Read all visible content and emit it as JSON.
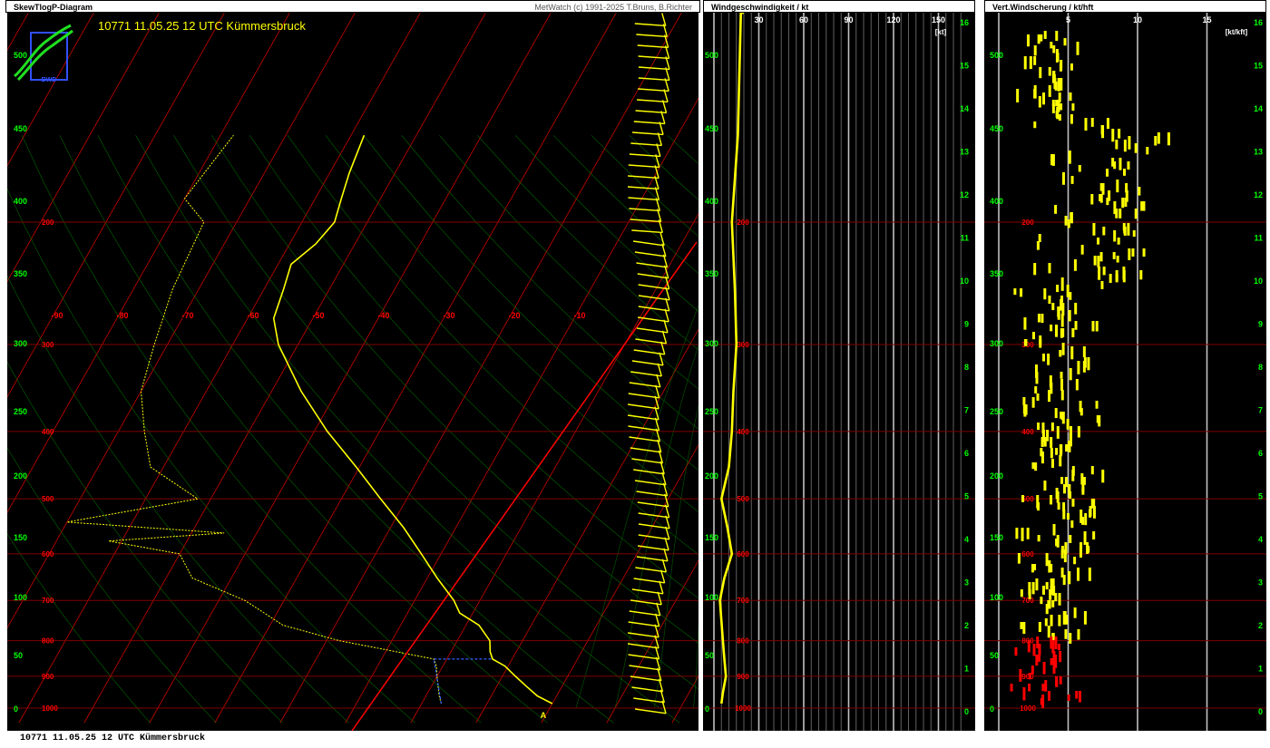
{
  "panels": {
    "skewt": {
      "title": "SkewTlogP-Diagram",
      "credit": "MetWatch  (c) 1991-2025 T.Bruns, B.Richter"
    },
    "wind": {
      "title": "Windgeschwindigkeit / kt"
    },
    "shear": {
      "title": "Vert.Windscherung / kt/hft"
    }
  },
  "station_label": "10771 11.05.25 12 UTC Kümmersbruck",
  "footer": "10771 11.05.25 12 UTC Kümmersbruck",
  "logo": {
    "text": "DWD",
    "icon": "dwd-logo-icon"
  },
  "colors": {
    "background": "#000000",
    "isotherm": "#ff0000",
    "isobar": "#800000",
    "adiabat": "#008000",
    "profile": "#ffff00",
    "parcel": "#ff0000",
    "level_text": "#00ff00",
    "shear_low": "#ff0000"
  },
  "chart_data": [
    {
      "type": "line",
      "name": "skewt",
      "pressure_levels": [
        "200",
        "300",
        "400",
        "500",
        "600",
        "700",
        "800",
        "900",
        "1000"
      ],
      "temperature_ticks": [
        "-90",
        "-80",
        "-70",
        "-60",
        "-50",
        "-40",
        "-30",
        "-20",
        "-10"
      ],
      "height_ticks_hpa": [
        "500",
        "450",
        "400",
        "350",
        "300",
        "250",
        "200",
        "150",
        "100",
        "50",
        "0"
      ],
      "height_ticks_km": [
        "16",
        "15",
        "14",
        "13",
        "12",
        "11",
        "10",
        "9",
        "8",
        "7",
        "6",
        "5",
        "4",
        "3",
        "2",
        "1",
        "0"
      ],
      "temperature_profile": {
        "p": [
          985,
          960,
          930,
          900,
          870,
          850,
          830,
          800,
          760,
          730,
          700,
          650,
          600,
          550,
          500,
          450,
          400,
          350,
          300,
          275,
          250,
          230,
          215,
          200,
          185,
          170,
          150
        ],
        "t": [
          20,
          17,
          14.5,
          12,
          9.5,
          7,
          6,
          5,
          2,
          -2,
          -4,
          -8.5,
          -13,
          -18,
          -24,
          -30.5,
          -38,
          -45.5,
          -53,
          -56,
          -57,
          -58,
          -56,
          -55,
          -56,
          -57,
          -58
        ]
      },
      "dewpoint_profile": {
        "p": [
          985,
          960,
          930,
          900,
          870,
          850,
          800,
          760,
          700,
          650,
          600,
          575,
          560,
          540,
          500,
          450,
          400,
          350,
          300,
          250,
          200,
          185,
          150
        ],
        "t": [
          3,
          2,
          1,
          0,
          -1,
          -2,
          -18,
          -28,
          -36,
          -46,
          -50,
          -62,
          -45,
          -70,
          -52,
          -62,
          -66,
          -70,
          -72,
          -74,
          -75,
          -80,
          -78
        ]
      },
      "parcel_path": {
        "p": [
          985,
          850,
          700,
          500,
          300,
          250,
          200
        ],
        "t": [
          20,
          5,
          -8,
          -25,
          -50,
          -58,
          -66
        ]
      },
      "parcel_label": "A"
    },
    {
      "type": "line",
      "name": "wind_speed",
      "x_ticks": [
        "30",
        "60",
        "90",
        "120",
        "150"
      ],
      "unit": "[kt]",
      "xlim": [
        0,
        165
      ],
      "height_ticks_hpa": [
        "500",
        "450",
        "400",
        "350",
        "300",
        "250",
        "200",
        "150",
        "100",
        "50",
        "0"
      ],
      "height_ticks_km": [
        "16",
        "15",
        "14",
        "13",
        "12",
        "11",
        "10",
        "9",
        "8",
        "7",
        "6",
        "5",
        "4",
        "3",
        "2",
        "1",
        "0"
      ],
      "profile": {
        "p": [
          985,
          950,
          900,
          850,
          800,
          750,
          700,
          650,
          600,
          550,
          500,
          450,
          400,
          350,
          300,
          250,
          200,
          150
        ],
        "speed": [
          5,
          6,
          8,
          7,
          6,
          5,
          4,
          7,
          12,
          9,
          5,
          10,
          12,
          13,
          15,
          14,
          12,
          16
        ]
      }
    },
    {
      "type": "scatter",
      "name": "vertical_wind_shear",
      "x_ticks": [
        "5",
        "10",
        "15"
      ],
      "unit": "[kt/kft]",
      "xlim": [
        0,
        17
      ],
      "height_ticks_hpa": [
        "500",
        "450",
        "400",
        "350",
        "300",
        "250",
        "200",
        "150",
        "100",
        "50",
        "0"
      ],
      "height_ticks_km": [
        "16",
        "15",
        "14",
        "13",
        "12",
        "11",
        "10",
        "9",
        "8",
        "7",
        "6",
        "5",
        "4",
        "3",
        "2",
        "1",
        "0"
      ]
    }
  ]
}
